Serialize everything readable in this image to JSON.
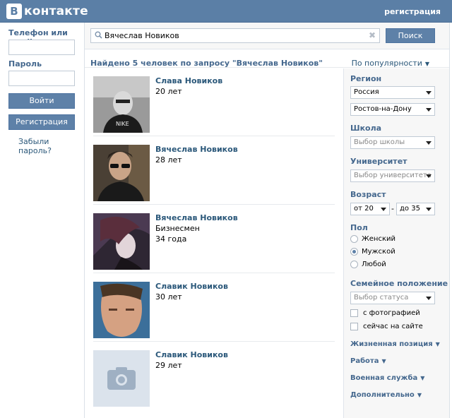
{
  "header": {
    "logo_mark": "В",
    "logo_text": "контакте",
    "register_link": "регистрация"
  },
  "login": {
    "phone_label": "Телефон или email",
    "password_label": "Пароль",
    "login_button": "Войти",
    "register_button": "Регистрация",
    "forgot_link": "Забыли пароль?"
  },
  "search": {
    "query": "Вячеслав Новиков",
    "clear": "✖",
    "button": "Поиск"
  },
  "summary": {
    "text": "Найдено 5 человек по запросу \"Вячеслав Новиков\"",
    "sort": "По популярности"
  },
  "results": [
    {
      "name": "Слава Новиков",
      "lines": [
        "20 лет"
      ]
    },
    {
      "name": "Вячеслав Новиков",
      "lines": [
        "28 лет"
      ]
    },
    {
      "name": "Вячеслав Новиков",
      "lines": [
        "Бизнесмен",
        "34 года"
      ]
    },
    {
      "name": "Славик Новиков",
      "lines": [
        "30 лет"
      ]
    },
    {
      "name": "Славик Новиков",
      "lines": [
        "29 лет"
      ]
    }
  ],
  "filters": {
    "region_label": "Регион",
    "country": "Россия",
    "city": "Ростов-на-Дону",
    "school_label": "Школа",
    "school_placeholder": "Выбор школы",
    "university_label": "Университет",
    "university_placeholder": "Выбор университета",
    "age_label": "Возраст",
    "age_from": "от 20",
    "age_sep": "-",
    "age_to": "до 35",
    "sex_label": "Пол",
    "sex_options": [
      "Женский",
      "Мужской",
      "Любой"
    ],
    "sex_selected": "Мужской",
    "marital_label": "Семейное положение",
    "marital_placeholder": "Выбор статуса",
    "with_photo": "с фотографией",
    "online_now": "сейчас на сайте",
    "life_position": "Жизненная позиция",
    "work": "Работа",
    "military": "Военная служба",
    "additional": "Дополнительно"
  },
  "colors": {
    "header_bg": "#5b7fa6",
    "link": "#2b587a",
    "heading": "#45688e",
    "button_bg": "#5e81a8"
  }
}
